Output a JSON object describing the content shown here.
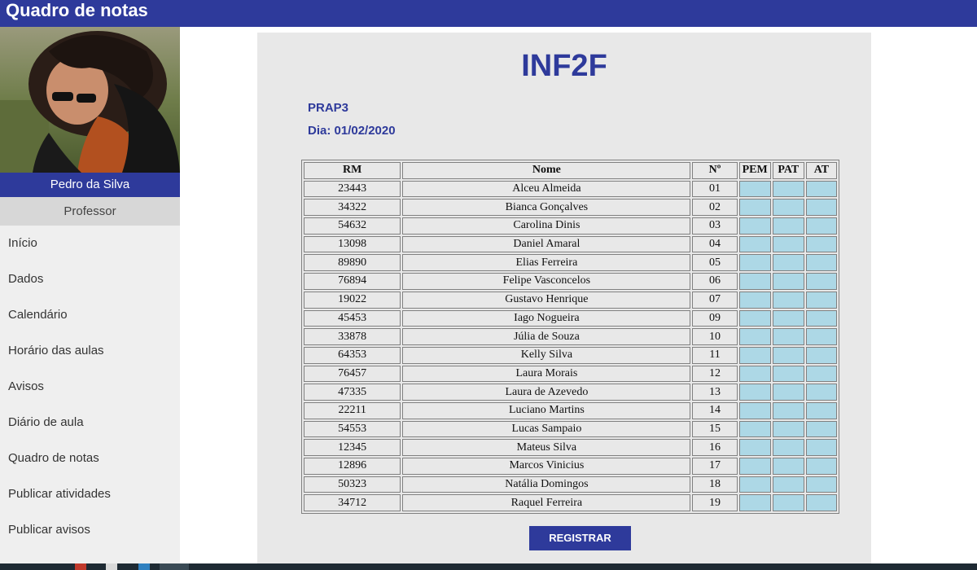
{
  "header": {
    "title": "Quadro de notas"
  },
  "sidebar": {
    "user_name": "Pedro da Silva",
    "user_role": "Professor",
    "items": [
      {
        "label": "Início"
      },
      {
        "label": "Dados"
      },
      {
        "label": "Calendário"
      },
      {
        "label": "Horário das aulas"
      },
      {
        "label": "Avisos"
      },
      {
        "label": "Diário de aula"
      },
      {
        "label": "Quadro de notas"
      },
      {
        "label": "Publicar atividades"
      },
      {
        "label": "Publicar avisos"
      }
    ]
  },
  "main": {
    "class_code": "INF2F",
    "subject": "PRAP3",
    "date_label": "Dia: 01/02/2020",
    "table": {
      "headers": [
        "RM",
        "Nome",
        "Nº",
        "PEM",
        "PAT",
        "AT"
      ],
      "rows": [
        {
          "rm": "23443",
          "nome": "Alceu Almeida",
          "numero": "01"
        },
        {
          "rm": "34322",
          "nome": "Bianca Gonçalves",
          "numero": "02"
        },
        {
          "rm": "54632",
          "nome": "Carolina Dinis",
          "numero": "03"
        },
        {
          "rm": "13098",
          "nome": "Daniel Amaral",
          "numero": "04"
        },
        {
          "rm": "89890",
          "nome": "Elias Ferreira",
          "numero": "05"
        },
        {
          "rm": "76894",
          "nome": "Felipe Vasconcelos",
          "numero": "06"
        },
        {
          "rm": "19022",
          "nome": "Gustavo Henrique",
          "numero": "07"
        },
        {
          "rm": "45453",
          "nome": "Iago Nogueira",
          "numero": "09"
        },
        {
          "rm": "33878",
          "nome": "Júlia de Souza",
          "numero": "10"
        },
        {
          "rm": "64353",
          "nome": "Kelly Silva",
          "numero": "11"
        },
        {
          "rm": "76457",
          "nome": "Laura Morais",
          "numero": "12"
        },
        {
          "rm": "47335",
          "nome": "Laura de Azevedo",
          "numero": "13"
        },
        {
          "rm": "22211",
          "nome": "Luciano Martins",
          "numero": "14"
        },
        {
          "rm": "54553",
          "nome": "Lucas Sampaio",
          "numero": "15"
        },
        {
          "rm": "12345",
          "nome": "Mateus Silva",
          "numero": "16"
        },
        {
          "rm": "12896",
          "nome": "Marcos Vinicius",
          "numero": "17"
        },
        {
          "rm": "50323",
          "nome": "Natália Domingos",
          "numero": "18"
        },
        {
          "rm": "34712",
          "nome": "Raquel Ferreira",
          "numero": "19"
        }
      ]
    },
    "register_label": "REGISTRAR"
  },
  "colors": {
    "brand": "#2e3a9b",
    "grade_cell": "#add8e6",
    "content_bg": "#e8e8e8",
    "sidebar_bg": "#efefef"
  },
  "icons": [
    "profile-photo"
  ]
}
